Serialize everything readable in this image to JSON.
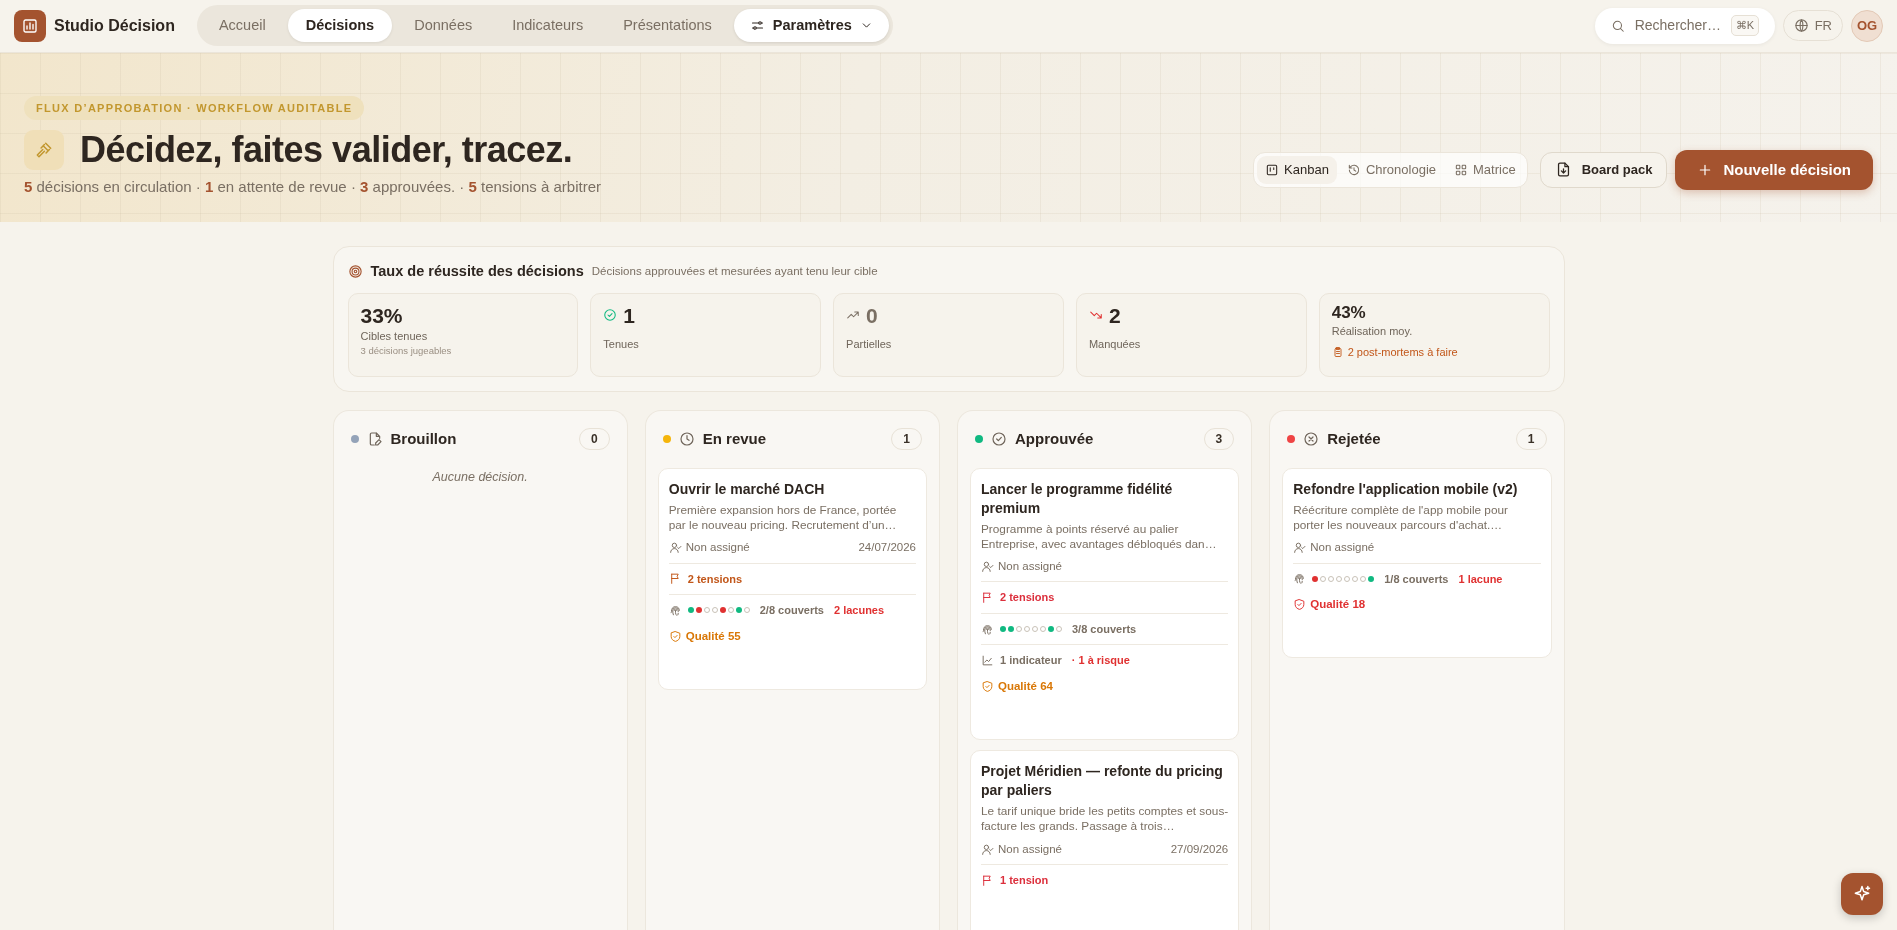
{
  "app": {
    "name": "Studio Décision"
  },
  "nav": {
    "tabs": [
      {
        "label": "Accueil",
        "selected": false
      },
      {
        "label": "Décisions",
        "selected": true
      },
      {
        "label": "Données",
        "selected": false
      },
      {
        "label": "Indicateurs",
        "selected": false
      },
      {
        "label": "Présentations",
        "selected": false
      }
    ],
    "settings": {
      "label": "Paramètres"
    }
  },
  "search": {
    "placeholder": "Rechercher…",
    "shortcut": "⌘K"
  },
  "language": {
    "label": "FR"
  },
  "user": {
    "initials": "OG"
  },
  "hero": {
    "eyebrow": "FLUX D’APPROBATION · WORKFLOW AUDITABLE",
    "title": "Décidez, faites valider, tracez.",
    "summary": "**5** décisions en circulation · **1** en attente de revue · **3** approuvées. · **5** tensions à arbitrer"
  },
  "views": [
    {
      "kind": "kanban",
      "label": "Kanban",
      "selected": true
    },
    {
      "kind": "timeline",
      "label": "Chronologie",
      "selected": false
    },
    {
      "kind": "matrix",
      "label": "Matrice",
      "selected": false
    }
  ],
  "board_pack": {
    "label": "Board pack"
  },
  "new_decision": {
    "label": "Nouvelle décision"
  },
  "success": {
    "title": "Taux de réussite des décisions",
    "subtitle": "Décisions approuvées et mesurées ayant tenu leur cible",
    "stats": [
      {
        "kind": "rate",
        "value": "33%",
        "label": "Cibles tenues",
        "note": "3 décisions jugeables"
      },
      {
        "kind": "kept",
        "value": "1",
        "label": "Tenues"
      },
      {
        "kind": "partial",
        "value": "0",
        "label": "Partielles"
      },
      {
        "kind": "missed",
        "value": "2",
        "label": "Manquées"
      },
      {
        "kind": "average",
        "value": "43%",
        "label": "Réalisation moy.",
        "action": "2 post-mortems à faire"
      }
    ]
  },
  "columns": [
    {
      "kind": "draft",
      "title": "Brouillon",
      "count": "0",
      "color": "#94a3b8",
      "empty_text": "Aucune décision."
    },
    {
      "kind": "review",
      "title": "En revue",
      "count": "1",
      "color": "#f5b50a",
      "cards": [
        {
          "title": "Ouvrir le marché DACH",
          "description": "Première expansion hors de France, portée par le nouveau pricing. Recrutement d’un…",
          "owner": "Non assigné",
          "date": "24/07/2026",
          "tensions": {
            "label": "2 tensions",
            "color": "#c2571a"
          },
          "coverage": {
            "dots": [
              {
                "kind": "covered"
              },
              {
                "kind": "gap"
              },
              {
                "kind": "empty"
              },
              {
                "kind": "empty"
              },
              {
                "kind": "gap"
              },
              {
                "kind": "empty"
              },
              {
                "kind": "covered"
              },
              {
                "kind": "empty"
              }
            ],
            "label": "2/8 couverts",
            "gaps": "2 lacunes"
          },
          "quality": {
            "label": "Qualité 55",
            "color": "#d97706"
          }
        }
      ]
    },
    {
      "kind": "approved",
      "title": "Approuvée",
      "count": "3",
      "color": "#10b981",
      "cards": [
        {
          "title": "Lancer le programme fidélité premium",
          "description": "Programme à points réservé au palier Entreprise, avec avantages débloqués dan…",
          "owner": "Non assigné",
          "tensions": {
            "label": "2 tensions",
            "color": "#dc2f3c"
          },
          "coverage": {
            "dots": [
              {
                "kind": "covered"
              },
              {
                "kind": "covered"
              },
              {
                "kind": "empty"
              },
              {
                "kind": "empty"
              },
              {
                "kind": "empty"
              },
              {
                "kind": "empty"
              },
              {
                "kind": "covered"
              },
              {
                "kind": "empty"
              }
            ],
            "label": "3/8 couverts"
          },
          "indicators": {
            "label": "1 indicateur",
            "risk": "· 1 à risque"
          },
          "quality": {
            "label": "Qualité 64",
            "color": "#d97706"
          }
        },
        {
          "title": "Projet Méridien — refonte du pricing par paliers",
          "description": "Le tarif unique bride les petits comptes et sous-facture les grands. Passage à trois…",
          "owner": "Non assigné",
          "date": "27/09/2026",
          "tensions": {
            "label": "1 tension",
            "color": "#dc2f3c"
          }
        }
      ]
    },
    {
      "kind": "rejected",
      "title": "Rejetée",
      "count": "1",
      "color": "#ef4444",
      "cards": [
        {
          "title": "Refondre l'application mobile (v2)",
          "description": "Réécriture complète de l'app mobile pour porter les nouveaux parcours d'achat.…",
          "owner": "Non assigné",
          "coverage": {
            "dots": [
              {
                "kind": "gap"
              },
              {
                "kind": "empty"
              },
              {
                "kind": "empty"
              },
              {
                "kind": "empty"
              },
              {
                "kind": "empty"
              },
              {
                "kind": "empty"
              },
              {
                "kind": "empty"
              },
              {
                "kind": "covered"
              }
            ],
            "label": "1/8 couverts",
            "gaps": "1 lacune"
          },
          "quality": {
            "label": "Qualité 18",
            "color": "#e03131"
          }
        }
      ]
    }
  ]
}
